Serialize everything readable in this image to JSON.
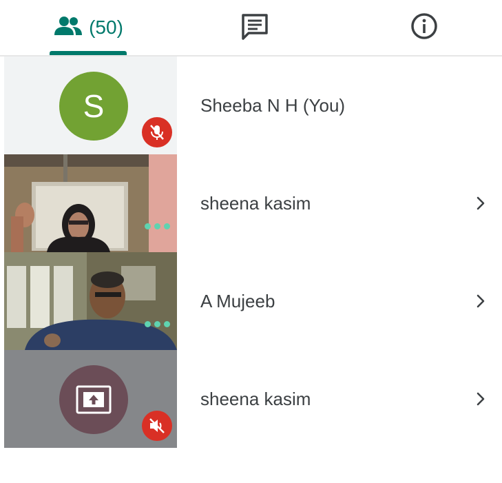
{
  "tabs": {
    "people": {
      "icon": "people-icon",
      "count_label": "(50)",
      "selected": true
    },
    "chat": {
      "icon": "chat-icon"
    },
    "info": {
      "icon": "info-icon"
    }
  },
  "participants": [
    {
      "name": "Sheeba N H (You)",
      "tile": "avatar",
      "avatar_letter": "S",
      "avatar_color": "#72a233",
      "status_icon": "mic-off-icon",
      "has_chevron": false
    },
    {
      "name": "sheena kasim",
      "tile": "video",
      "status_icon": "speaking-dots-icon",
      "has_chevron": true
    },
    {
      "name": "A Mujeeb",
      "tile": "video",
      "status_icon": "speaking-dots-icon",
      "has_chevron": true
    },
    {
      "name": "sheena kasim",
      "tile": "presentation",
      "status_icon": "volume-off-icon",
      "has_chevron": true
    }
  ],
  "colors": {
    "accent": "#00796b",
    "mute_badge": "#d93025",
    "speaking_dots": "#5fd3b0",
    "presentation_circle": "#6b4d57"
  }
}
